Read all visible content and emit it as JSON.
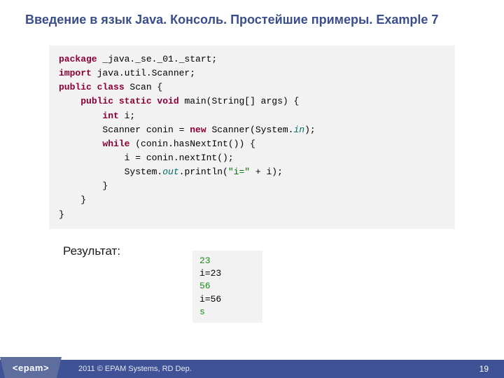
{
  "title": "Введение в язык Java. Консоль. Простейшие примеры. Example 7",
  "code": {
    "line1_kw": "package",
    "line1_rest": " _java._se._01._start;",
    "line2_kw": "import",
    "line2_rest": " java.util.Scanner;",
    "line3_kw": "public class",
    "line3_rest": " Scan {",
    "line4_kw": "public static void",
    "line4_rest": " main(String[] args) {",
    "line5_kw": "int",
    "line5_rest": " i;",
    "line6_pre": "        Scanner conin = ",
    "line6_kw": "new",
    "line6_mid": " Scanner(System.",
    "line6_field": "in",
    "line6_end": ");",
    "line7_kw": "while",
    "line7_rest": " (conin.hasNextInt()) {",
    "line8": "            i = conin.nextInt();",
    "line9_pre": "            System.",
    "line9_field": "out",
    "line9_mid": ".println(",
    "line9_str": "\"i=\"",
    "line9_end": " + i);",
    "line10": "        }",
    "line11": "    }",
    "line12": "}"
  },
  "resultLabel": "Результат:",
  "console": {
    "l1": "23",
    "l2": "i=23",
    "l3": "56",
    "l4": "i=56",
    "l5": "s"
  },
  "footer": {
    "logo": "<epam>",
    "copyright": "2011 © EPAM Systems, RD Dep.",
    "page": "19"
  }
}
